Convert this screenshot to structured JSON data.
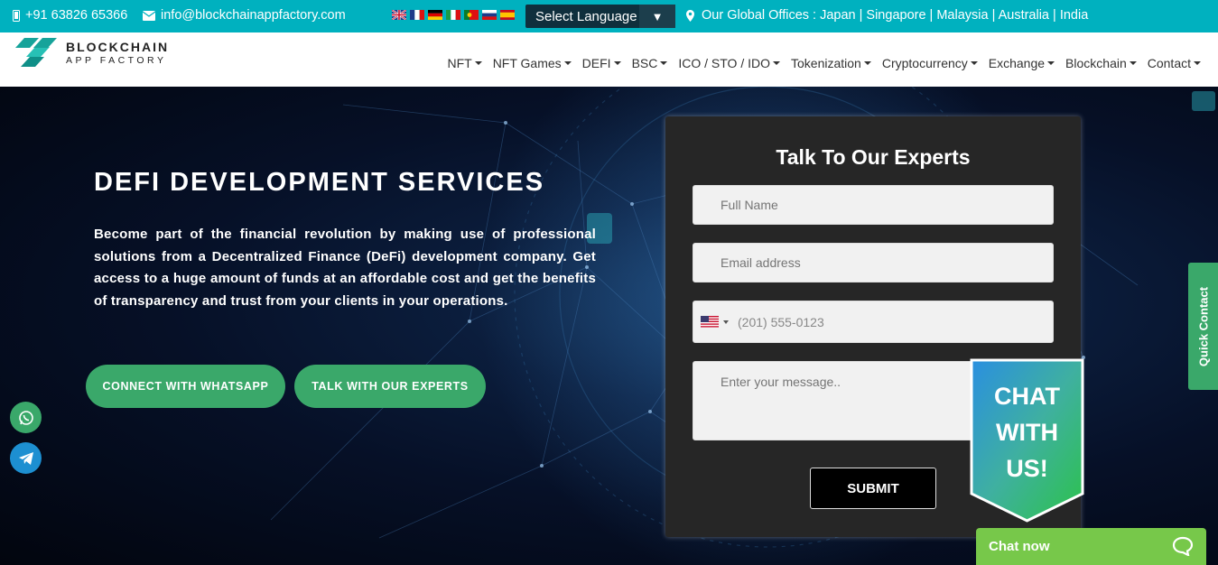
{
  "topbar": {
    "phone": "+91 63826 65366",
    "email": "info@blockchainappfactory.com",
    "flags": [
      "english-flag",
      "french-flag",
      "german-flag",
      "italian-flag",
      "portuguese-flag",
      "russian-flag",
      "spanish-flag"
    ],
    "language_select": "Select Language",
    "offices": "Our Global Offices : Japan | Singapore | Malaysia | Australia | India"
  },
  "logo": {
    "line1": "BLOCKCHAIN",
    "line2": "APP FACTORY"
  },
  "nav": {
    "items": [
      {
        "label": "NFT"
      },
      {
        "label": "NFT Games"
      },
      {
        "label": "DEFI"
      },
      {
        "label": "BSC"
      },
      {
        "label": "ICO / STO / IDO"
      },
      {
        "label": "Tokenization"
      },
      {
        "label": "Cryptocurrency"
      },
      {
        "label": "Exchange"
      },
      {
        "label": "Blockchain"
      },
      {
        "label": "Contact"
      }
    ]
  },
  "hero": {
    "title": "DEFI DEVELOPMENT SERVICES",
    "description": "Become part of the financial revolution by making use of professional solutions from a Decentralized Finance (DeFi) development company. Get access to a huge amount of funds at an affordable cost and get the benefits of transparency and trust from your clients in your operations.",
    "btn_whatsapp": "CONNECT WITH WHATSAPP",
    "btn_experts": "TALK WITH OUR EXPERTS"
  },
  "form": {
    "title": "Talk To Our Experts",
    "name_placeholder": "Full Name",
    "email_placeholder": "Email address",
    "phone_placeholder": "(201) 555-0123",
    "message_placeholder": "Enter your message..",
    "submit": "SUBMIT"
  },
  "chat_badge": {
    "line1": "CHAT",
    "line2": "WITH",
    "line3": "US!"
  },
  "quick_contact": "Quick Contact",
  "chat_now": "Chat now",
  "colors": {
    "topbar": "#00b1bf",
    "green": "#3aa86a",
    "chat_now": "#77c84a",
    "form_bg": "#262626"
  }
}
